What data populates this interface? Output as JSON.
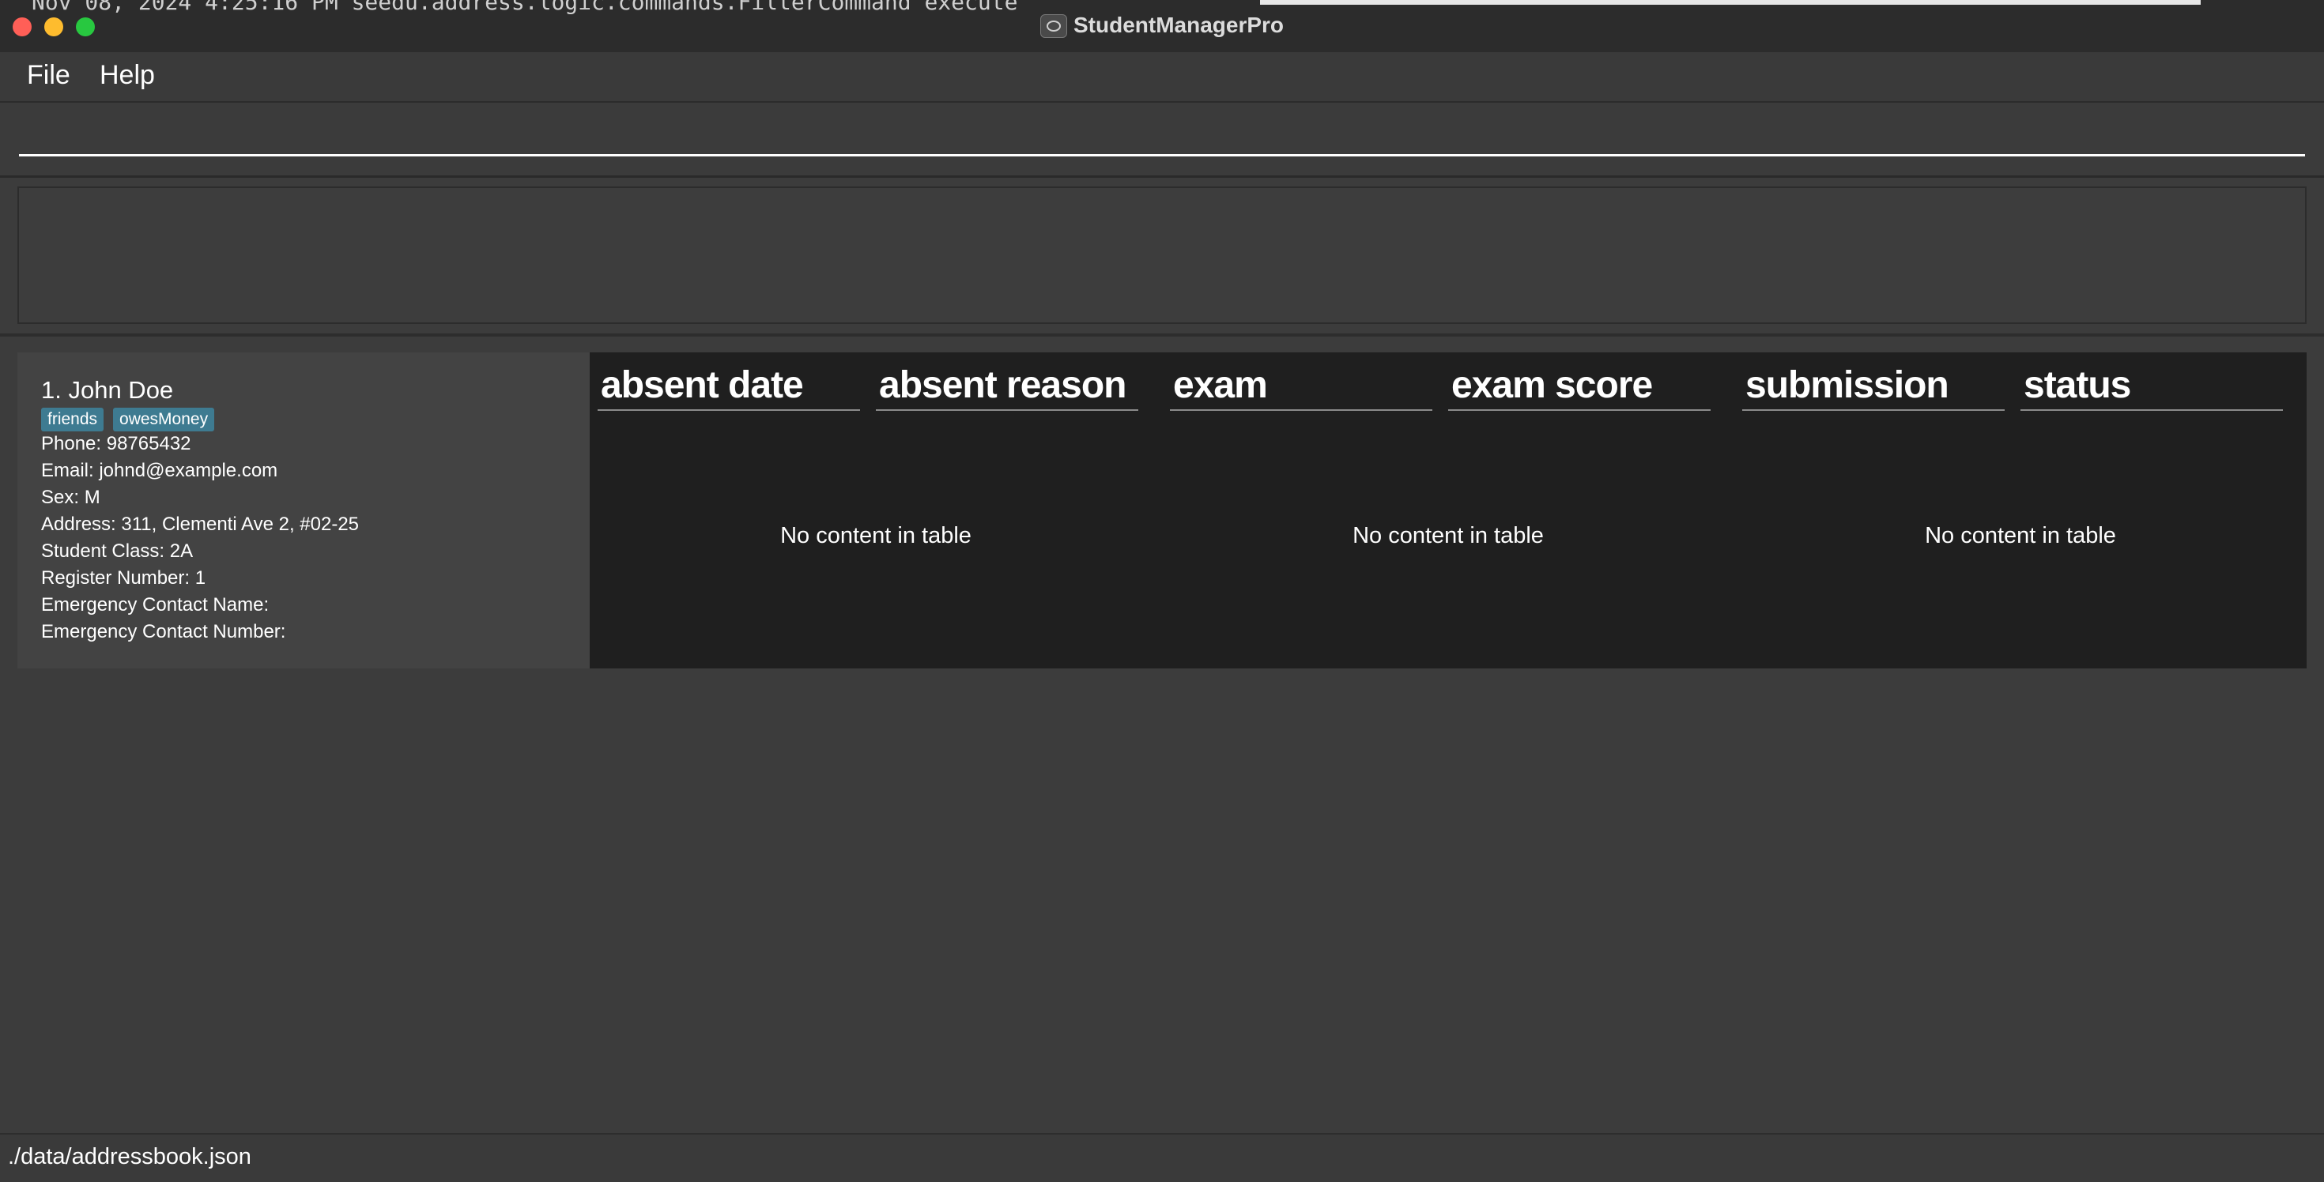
{
  "window": {
    "title": "StudentManagerPro",
    "background_terminal_text": "Nov 08, 2024 4:25:16 PM seedu.address.logic.commands.FilterCommand execute"
  },
  "menu": {
    "file_label": "File",
    "help_label": "Help"
  },
  "command_box": {
    "value": "",
    "placeholder": ""
  },
  "result_display": {
    "text": ""
  },
  "person": {
    "name": "1. John Doe",
    "tags": [
      "friends",
      "owesMoney"
    ],
    "phone": "Phone: 98765432",
    "email": "Email: johnd@example.com",
    "sex": "Sex: M",
    "address": "Address: 311, Clementi Ave 2, #02-25",
    "student_class": "Student Class: 2A",
    "register_number": "Register Number: 1",
    "emergency_contact_name": "Emergency Contact Name:",
    "emergency_contact_number": "Emergency Contact Number:"
  },
  "tables": {
    "attendance": {
      "columns": [
        "absent date",
        "absent reason"
      ],
      "empty_text": "No content in table"
    },
    "exams": {
      "columns": [
        "exam",
        "exam score"
      ],
      "empty_text": "No content in table"
    },
    "submissions": {
      "columns": [
        "submission",
        "status"
      ],
      "empty_text": "No content in table"
    }
  },
  "status_bar": {
    "file_path": "./data/addressbook.json"
  },
  "colors": {
    "tag_background": "#3e7b91",
    "window_background": "#3c3c3c",
    "table_background": "#1f1f1f",
    "card_background": "#434343"
  }
}
